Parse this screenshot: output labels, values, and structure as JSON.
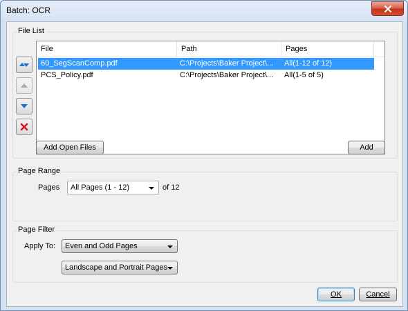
{
  "window": {
    "title": "Batch: OCR"
  },
  "file_list": {
    "group_label": "File List",
    "columns": [
      "File",
      "Path",
      "Pages"
    ],
    "rows": [
      {
        "file": "60_SegScanComp.pdf",
        "path": "C:\\Projects\\Baker Project\\...",
        "pages": "All(1-12 of 12)",
        "selected": true
      },
      {
        "file": "PCS_Policy.pdf",
        "path": "C:\\Projects\\Baker Project\\...",
        "pages": "All(1-5 of 5)",
        "selected": false
      }
    ],
    "add_open_files_label": "Add Open Files",
    "add_label": "Add"
  },
  "page_range": {
    "group_label": "Page Range",
    "pages_label": "Pages",
    "pages_value": "All Pages (1 - 12)",
    "of_text": "of 12"
  },
  "page_filter": {
    "group_label": "Page Filter",
    "apply_to_label": "Apply To:",
    "parity_value": "Even and Odd Pages",
    "orientation_value": "Landscape and Portrait Pages"
  },
  "footer": {
    "ok_label": "OK",
    "cancel_label": "Cancel"
  },
  "colors": {
    "selection": "#3399ff",
    "close_button": "#c1331b",
    "accent_blue": "#1e6fd0"
  }
}
